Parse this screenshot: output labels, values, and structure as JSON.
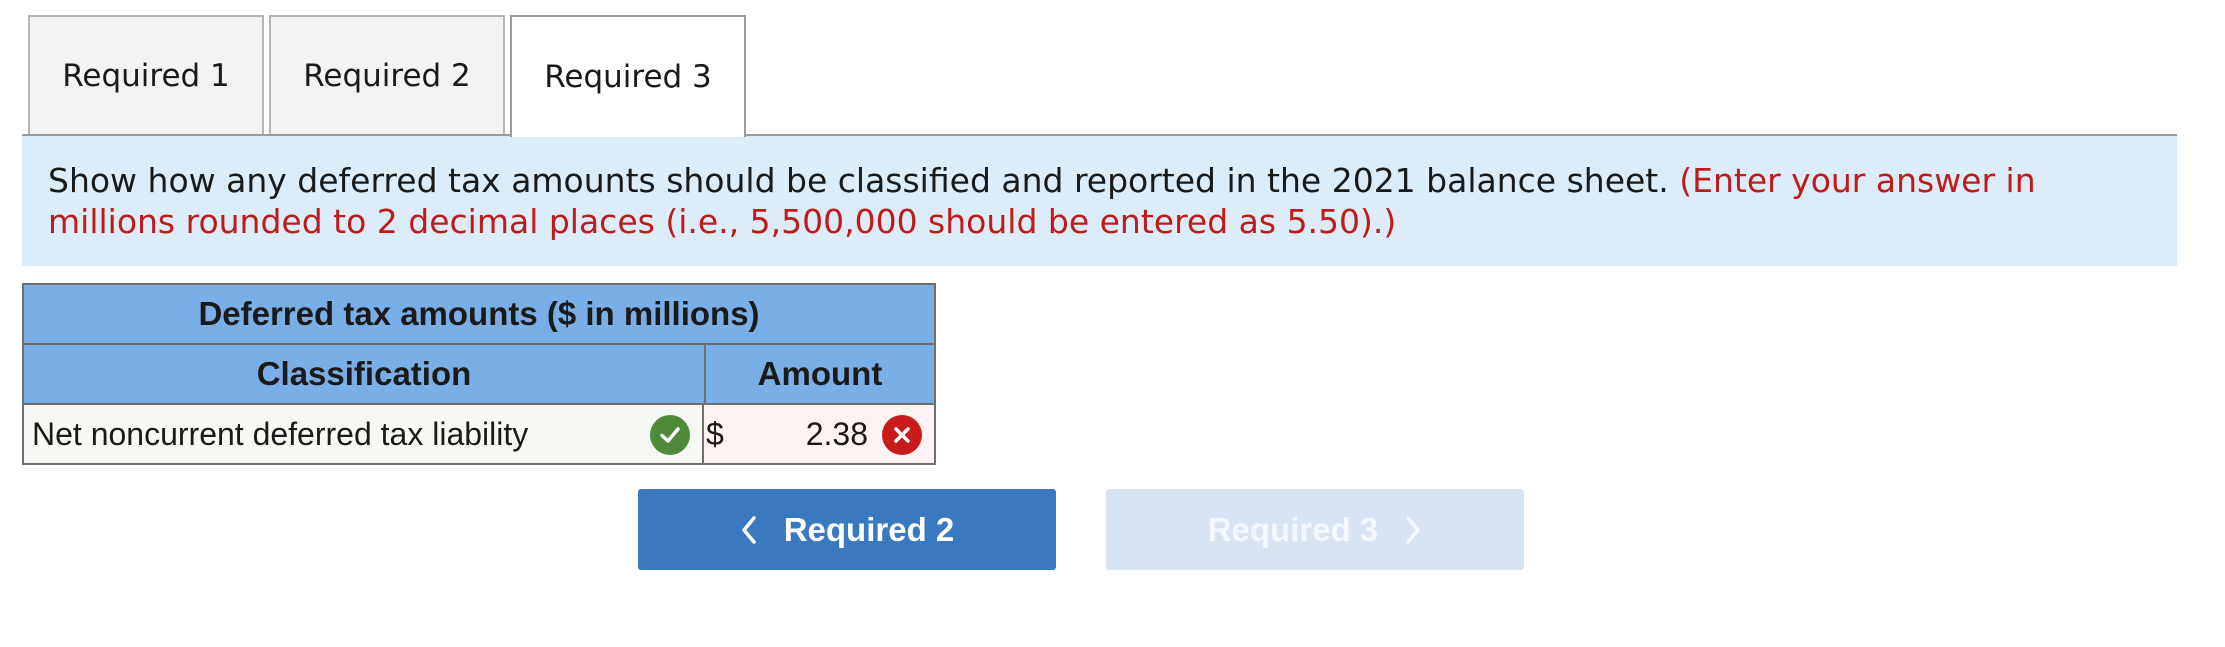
{
  "tabs": [
    {
      "label": "Required 1",
      "active": false
    },
    {
      "label": "Required 2",
      "active": false
    },
    {
      "label": "Required 3",
      "active": true
    }
  ],
  "instruction": {
    "text": "Show how any deferred tax amounts should be classified and reported in the 2021 balance sheet.",
    "note": "(Enter your answer in millions rounded to 2 decimal places (i.e., 5,500,000 should be entered as 5.50).)"
  },
  "table": {
    "title": "Deferred tax amounts ($ in millions)",
    "col_classification": "Classification",
    "col_amount": "Amount",
    "rows": [
      {
        "classification": "Net noncurrent deferred tax liability",
        "classification_status": "correct",
        "currency": "$",
        "amount": "2.38",
        "amount_status": "incorrect"
      }
    ]
  },
  "nav": {
    "prev_label": "Required 2",
    "next_label": "Required 3",
    "next_enabled": false
  },
  "colors": {
    "header_blue": "#7aaee6",
    "instruction_bg": "#dcecf8",
    "note_red": "#c01b1b",
    "primary_button": "#3a78bf",
    "disabled_button": "#d8e4f1",
    "check_green": "#4f8a3a",
    "error_red": "#c81c1c"
  }
}
